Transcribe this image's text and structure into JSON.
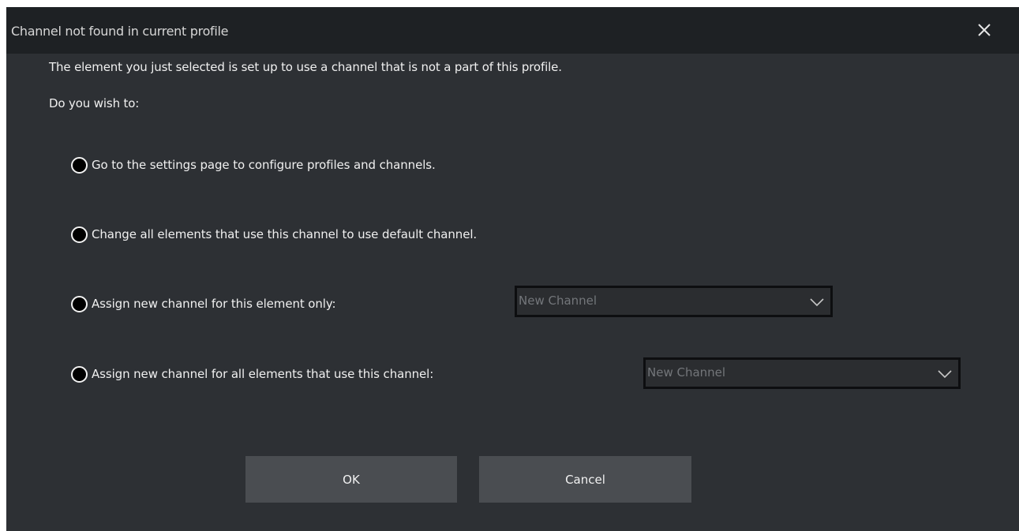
{
  "dialog": {
    "title": "Channel not found in current profile",
    "message": "The element you just selected is set up to use a channel that is not a part of this profile.",
    "prompt": "Do you wish to:",
    "options": [
      {
        "label": "Go to the settings page to configure profiles and channels."
      },
      {
        "label": "Change all elements that use this channel to use default channel."
      },
      {
        "label": "Assign new channel for this element only:",
        "select_value": "New Channel"
      },
      {
        "label": "Assign new channel for all elements that use this channel:",
        "select_value": "New Channel"
      }
    ],
    "ok_label": "OK",
    "cancel_label": "Cancel"
  },
  "icons": {
    "close": "close-icon",
    "dropdown": "chevron-down-icon",
    "radio": "radio-button"
  },
  "colors": {
    "background": "#2d3034",
    "titlebar": "#1e2124",
    "button": "#4a4d51",
    "text": "#f0f0f0",
    "select_text": "#73767a"
  }
}
